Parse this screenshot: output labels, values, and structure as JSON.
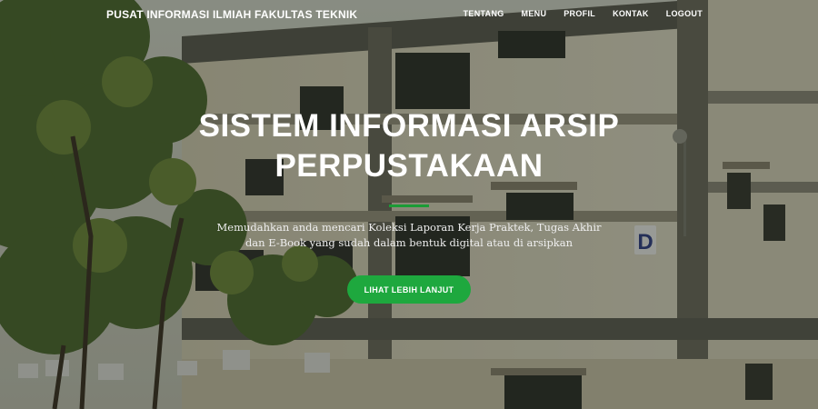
{
  "navbar": {
    "brand": "PUSAT INFORMASI ILMIAH FAKULTAS TEKNIK",
    "links": [
      "TENTANG",
      "MENU",
      "PROFIL",
      "KONTAK",
      "LOGOUT"
    ]
  },
  "hero": {
    "title": "SISTEM INFORMASI ARSIP PERPUSTAKAAN",
    "subtitle": "Memudahkan anda mencari Koleksi Laporan Kerja Praktek, Tugas Akhir dan E-Book yang sudah dalam bentuk digital atau di arsipkan",
    "cta_label": "LIHAT LEBIH LANJUT"
  },
  "background": {
    "building_sign": "D"
  },
  "colors": {
    "accent": "#1ea83e",
    "divider": "#1b9c36",
    "text": "#ffffff"
  }
}
